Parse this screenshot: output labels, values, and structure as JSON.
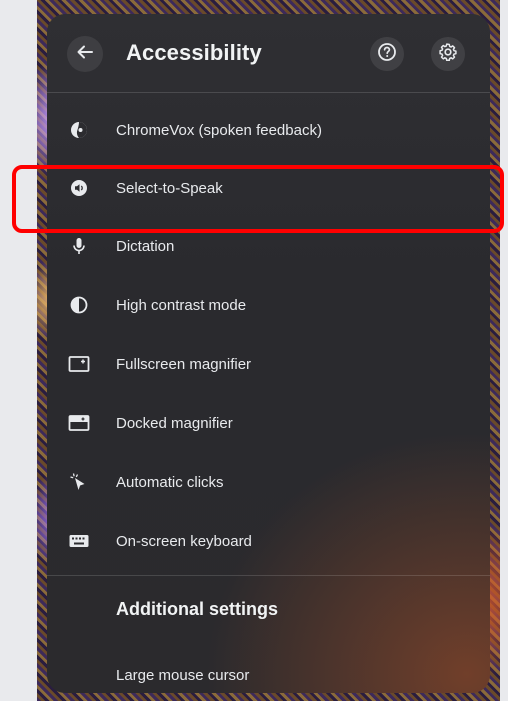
{
  "panel": {
    "title": "Accessibility",
    "back_icon": "arrow-left-icon",
    "help_icon": "help-circle-icon",
    "settings_icon": "gear-icon"
  },
  "items": [
    {
      "label": "ChromeVox (spoken feedback)",
      "icon": "chromevox-icon"
    },
    {
      "label": "Select-to-Speak",
      "icon": "select-to-speak-icon"
    },
    {
      "label": "Dictation",
      "icon": "microphone-icon"
    },
    {
      "label": "High contrast mode",
      "icon": "contrast-icon"
    },
    {
      "label": "Fullscreen magnifier",
      "icon": "fullscreen-magnifier-icon"
    },
    {
      "label": "Docked magnifier",
      "icon": "docked-magnifier-icon"
    },
    {
      "label": "Automatic clicks",
      "icon": "cursor-click-icon"
    },
    {
      "label": "On-screen keyboard",
      "icon": "keyboard-icon"
    }
  ],
  "additional": {
    "title": "Additional settings",
    "items": [
      {
        "label": "Large mouse cursor"
      }
    ]
  },
  "colors": {
    "highlight": "#ff0000",
    "panel_bg": "#2c2c30",
    "text": "#e8eaed"
  }
}
